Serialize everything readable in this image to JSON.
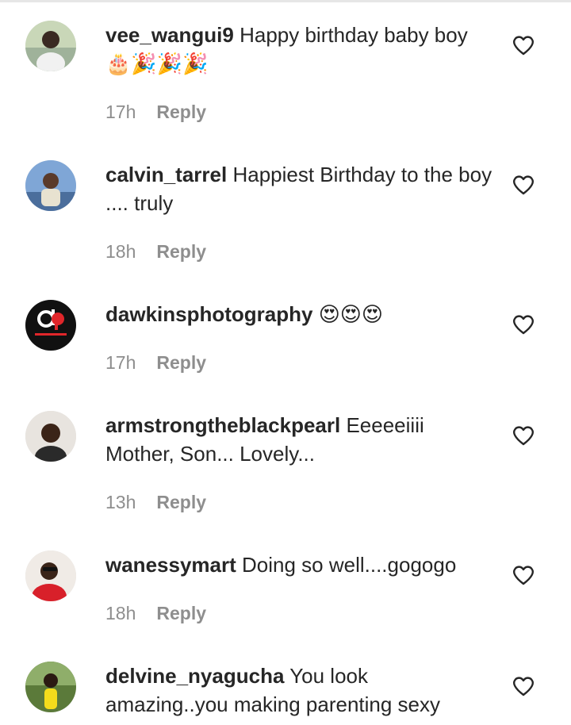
{
  "comments": [
    {
      "username": "vee_wangui9",
      "text": "Happy birthday baby boy",
      "emoji": "🎂🎉🎉🎉",
      "time": "17h",
      "reply_label": "Reply",
      "like_icon": "heart-outline-icon"
    },
    {
      "username": "calvin_tarrel",
      "text": "Happiest Birthday to the boy .... truly",
      "emoji": "",
      "time": "18h",
      "reply_label": "Reply",
      "like_icon": "heart-outline-icon"
    },
    {
      "username": "dawkinsphotography",
      "text": "",
      "emoji": "😍😍😍",
      "time": "17h",
      "reply_label": "Reply",
      "like_icon": "heart-outline-icon"
    },
    {
      "username": "armstrongtheblackpearl",
      "text": "Eeeeeiiii Mother, Son... Lovely...",
      "emoji": "",
      "time": "13h",
      "reply_label": "Reply",
      "like_icon": "heart-outline-icon"
    },
    {
      "username": "wanessymart",
      "text": "Doing so well....gogogo",
      "emoji": "",
      "time": "18h",
      "reply_label": "Reply",
      "like_icon": "heart-outline-icon"
    },
    {
      "username": "delvine_nyagucha",
      "text": "You look amazing..you making parenting sexy",
      "emoji": "",
      "time": "",
      "reply_label": "",
      "like_icon": "heart-outline-icon"
    }
  ],
  "colors": {
    "text": "#262626",
    "secondary": "#8e8e8e",
    "background": "#ffffff"
  }
}
